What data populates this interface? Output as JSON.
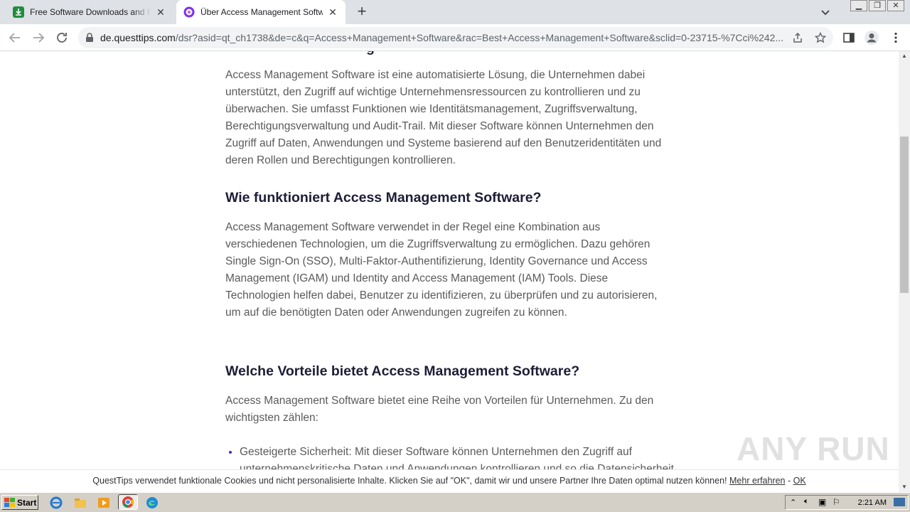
{
  "browser": {
    "tabs": [
      {
        "title": "Free Software Downloads and Reviews",
        "favicon": "download-site-icon"
      },
      {
        "title": "Über Access Management Software",
        "favicon": "questtips-icon"
      }
    ],
    "url_host": "de.questtips.com",
    "url_path": "/dsr?asid=qt_ch1738&de=c&q=Access+Management+Software&rac=Best+Access+Management+Software&sclid=0-23715-%7Cci%242..."
  },
  "article": {
    "top_heading_partial": "g",
    "p1": "Access Management Software ist eine automatisierte Lösung, die Unternehmen dabei unterstützt, den Zugriff auf wichtige Unternehmensressourcen zu kontrollieren und zu überwachen. Sie umfasst Funktionen wie Identitätsmanagement, Zugriffsverwaltung, Berechtigungsverwaltung und Audit-Trail. Mit dieser Software können Unternehmen den Zugriff auf Daten, Anwendungen und Systeme basierend auf den Benutzeridentitäten und deren Rollen und Berechtigungen kontrollieren.",
    "h2": "Wie funktioniert Access Management Software?",
    "p2": "Access Management Software verwendet in der Regel eine Kombination aus verschiedenen Technologien, um die Zugriffsverwaltung zu ermöglichen. Dazu gehören Single Sign-On (SSO), Multi-Faktor-Authentifizierung, Identity Governance und Access Management (IGAM) und Identity and Access Management (IAM) Tools. Diese Technologien helfen dabei, Benutzer zu identifizieren, zu überprüfen und zu autorisieren, um auf die benötigten Daten oder Anwendungen zugreifen zu können.",
    "h3": "Welche Vorteile bietet Access Management Software?",
    "p3": "Access Management Software bietet eine Reihe von Vorteilen für Unternehmen. Zu den wichtigsten zählen:",
    "li1": "Gesteigerte Sicherheit: Mit dieser Software können Unternehmen den Zugriff auf unternehmenskritische Daten und Anwendungen kontrollieren und so die Datensicherheit erhöhen."
  },
  "cookie": {
    "text": "QuestTips verwendet funktionale Cookies und nicht personalisierte Inhalte. Klicken Sie auf \"OK\", damit wir und unsere Partner Ihre Daten optimal nutzen können!",
    "more": "Mehr erfahren",
    "sep": "-",
    "ok": "OK"
  },
  "watermark": "ANY RUN",
  "taskbar": {
    "start": "Start",
    "clock": "2:21 AM"
  },
  "colors": {
    "heading": "#1d1d36",
    "body_text": "#5a5a5a",
    "bullet": "#6a1bbf",
    "tabstrip": "#dee1e6"
  }
}
